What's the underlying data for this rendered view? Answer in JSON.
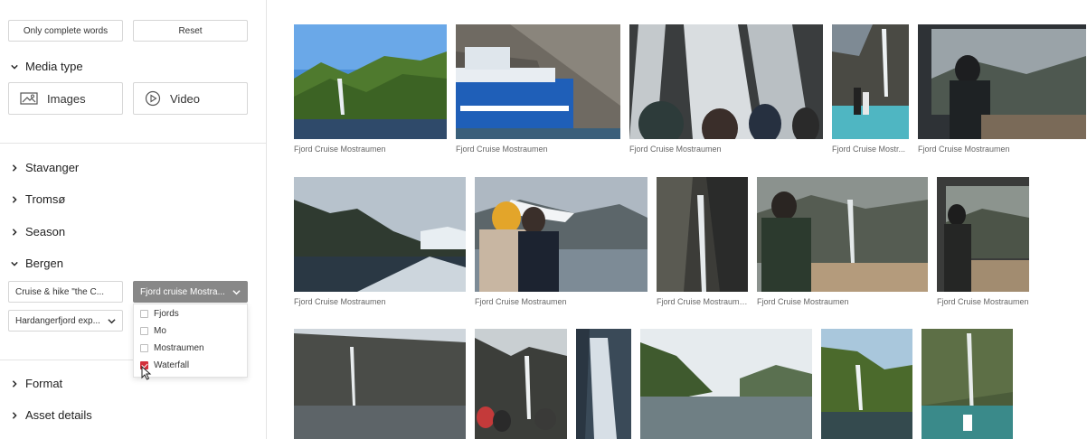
{
  "filters": {
    "only_complete_words": "Only complete words",
    "reset": "Reset",
    "media_type": {
      "title": "Media type",
      "images": "Images",
      "video": "Video"
    },
    "sections": {
      "stavanger": "Stavanger",
      "tromso": "Tromsø",
      "season": "Season",
      "bergen": "Bergen",
      "format": "Format",
      "asset_details": "Asset details"
    },
    "bergen": {
      "select_1": "Cruise & hike \"the C...",
      "select_2": "Fjord cruise Mostra...",
      "select_3": "Hardangerfjord exp...",
      "options": [
        "Fjords",
        "Mo",
        "Mostraumen",
        "Waterfall"
      ],
      "checked_option": "Waterfall"
    }
  },
  "gallery": {
    "row1_captions": [
      "Fjord Cruise Mostraumen",
      "Fjord Cruise Mostraumen",
      "Fjord Cruise Mostraumen",
      "Fjord Cruise Mostr...",
      "Fjord Cruise Mostraumen"
    ],
    "row2_captions": [
      "Fjord Cruise Mostraumen",
      "Fjord Cruise Mostraumen",
      "Fjord Cruise Mostraumen",
      "Fjord Cruise Mostraumen",
      "Fjord Cruise Mostraumen"
    ]
  },
  "colors": {
    "accent": "#d32f3a",
    "active_select": "#888888"
  }
}
